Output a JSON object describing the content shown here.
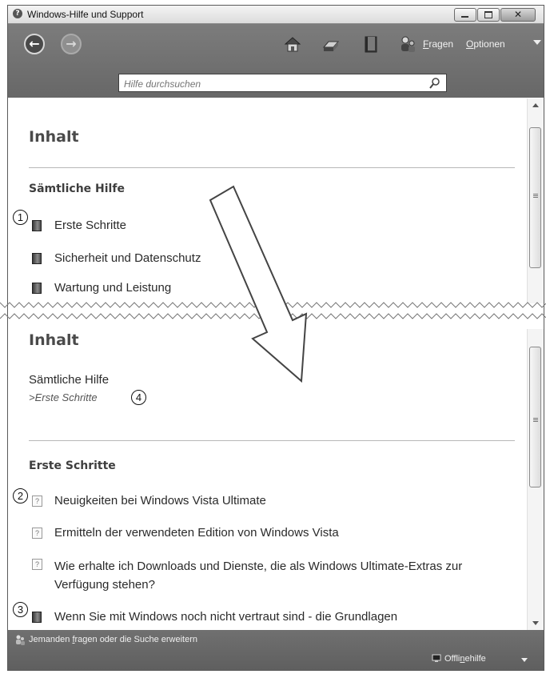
{
  "window": {
    "title": "Windows-Hilfe und Support"
  },
  "toolbar": {
    "back_icon": "back-arrow-icon",
    "forward_icon": "forward-arrow-icon",
    "links": [
      {
        "pre": "",
        "u": "F",
        "post": "ragen"
      },
      {
        "pre": "",
        "u": "O",
        "post": "ptionen"
      }
    ]
  },
  "search": {
    "placeholder": "Hilfe durchsuchen"
  },
  "panel1": {
    "heading": "Inhalt",
    "subheading": "Sämtliche Hilfe",
    "items": [
      {
        "label": "Erste Schritte"
      },
      {
        "label": "Sicherheit und Datenschutz"
      },
      {
        "label": "Wartung und Leistung"
      }
    ]
  },
  "panel2": {
    "heading": "Inhalt",
    "breadcrumb_link": "Sämtliche Hilfe",
    "breadcrumb_current": ">Erste Schritte",
    "subheading": "Erste Schritte",
    "items": [
      {
        "label": "Neuigkeiten bei Windows Vista Ultimate"
      },
      {
        "label": "Ermitteln der verwendeten Edition von Windows Vista"
      },
      {
        "label": "Wie erhalte ich Downloads und Dienste, die als Windows Ultimate-Extras zur Verfügung stehen?"
      },
      {
        "label": "Wenn Sie mit Windows noch nicht vertraut sind - die Grundlagen"
      }
    ]
  },
  "statusbar": {
    "ask_pre": "Jemanden ",
    "ask_u": "f",
    "ask_post": "ragen oder die Suche erweitern",
    "offline_pre": "Offli",
    "offline_u": "n",
    "offline_post": "ehilfe"
  },
  "callouts": [
    "1",
    "2",
    "3",
    "4"
  ],
  "colors": {
    "toolbar": "#6e6e6e",
    "statusbar": "#666666",
    "text": "#2a2a2a"
  }
}
